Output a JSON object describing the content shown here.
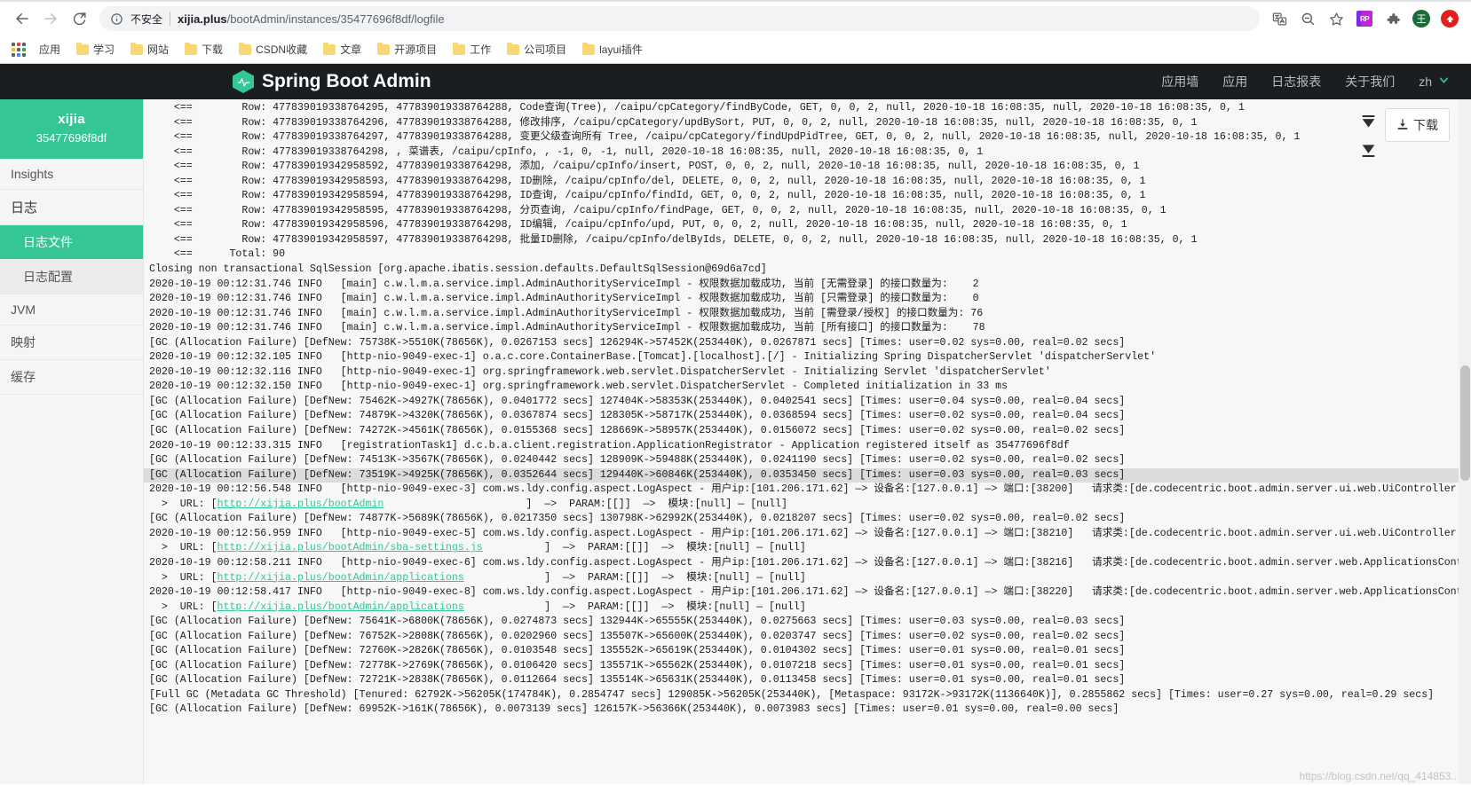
{
  "browser": {
    "back_icon": "back-arrow-icon",
    "forward_icon": "forward-arrow-icon",
    "reload_icon": "reload-icon",
    "security_label": "不安全",
    "url_host": "xijia.plus",
    "url_path": "/bootAdmin/instances/35477696f8df/logfile",
    "url_full": "xijia.plus/bootAdmin/instances/35477696f8df/logfile",
    "toolbar_icons": [
      "translate-icon",
      "zoom-out-icon",
      "bookmark-star-icon",
      "extension-rp-icon",
      "extensions-puzzle-icon",
      "profile-avatar",
      "update-icon"
    ],
    "extension_rp_label": "RP",
    "profile_initial": "王",
    "bookmarks": [
      {
        "label": "应用",
        "icon": "apps-grid-icon"
      },
      {
        "label": "学习",
        "icon": "folder-icon"
      },
      {
        "label": "网站",
        "icon": "folder-icon"
      },
      {
        "label": "下载",
        "icon": "folder-icon"
      },
      {
        "label": "CSDN收藏",
        "icon": "folder-icon"
      },
      {
        "label": "文章",
        "icon": "folder-icon"
      },
      {
        "label": "开源项目",
        "icon": "folder-icon"
      },
      {
        "label": "工作",
        "icon": "folder-icon"
      },
      {
        "label": "公司项目",
        "icon": "folder-icon"
      },
      {
        "label": "layui插件",
        "icon": "folder-icon"
      }
    ]
  },
  "header": {
    "title": "Spring Boot Admin",
    "logo_icon": "spring-boot-admin-hexagon-logo",
    "nav": [
      {
        "label": "应用墙"
      },
      {
        "label": "应用"
      },
      {
        "label": "日志报表"
      },
      {
        "label": "关于我们"
      }
    ],
    "language": "zh",
    "language_chevron_icon": "chevron-down-icon"
  },
  "sidebar": {
    "app_name": "xijia",
    "app_id": "35477696f8df",
    "items": [
      {
        "label": "Insights",
        "type": "item"
      },
      {
        "label": "日志",
        "type": "group"
      },
      {
        "label": "日志文件",
        "type": "sub",
        "active": true
      },
      {
        "label": "日志配置",
        "type": "sub",
        "active": false
      },
      {
        "label": "JVM",
        "type": "item"
      },
      {
        "label": "映射",
        "type": "item"
      },
      {
        "label": "缓存",
        "type": "item"
      }
    ]
  },
  "log_panel": {
    "download_label": "下载",
    "download_icon": "download-icon",
    "scroll_top_icon": "scroll-to-top-icon",
    "scroll_bottom_icon": "scroll-to-bottom-icon",
    "highlighted_line_index": 25,
    "lines": [
      "    <==        Row: 477839019338764295, 477839019338764288, Code查询(Tree), /caipu/cpCategory/findByCode, GET, 0, 0, 2, null, 2020-10-18 16:08:35, null, 2020-10-18 16:08:35, 0, 1",
      "    <==        Row: 477839019338764296, 477839019338764288, 修改排序, /caipu/cpCategory/updBySort, PUT, 0, 0, 2, null, 2020-10-18 16:08:35, null, 2020-10-18 16:08:35, 0, 1",
      "    <==        Row: 477839019338764297, 477839019338764288, 变更父级查询所有 Tree, /caipu/cpCategory/findUpdPidTree, GET, 0, 0, 2, null, 2020-10-18 16:08:35, null, 2020-10-18 16:08:35, 0, 1",
      "    <==        Row: 477839019338764298, , 菜谱表, /caipu/cpInfo, , -1, 0, -1, null, 2020-10-18 16:08:35, null, 2020-10-18 16:08:35, 0, 1",
      "    <==        Row: 477839019342958592, 477839019338764298, 添加, /caipu/cpInfo/insert, POST, 0, 0, 2, null, 2020-10-18 16:08:35, null, 2020-10-18 16:08:35, 0, 1",
      "    <==        Row: 477839019342958593, 477839019338764298, ID删除, /caipu/cpInfo/del, DELETE, 0, 0, 2, null, 2020-10-18 16:08:35, null, 2020-10-18 16:08:35, 0, 1",
      "    <==        Row: 477839019342958594, 477839019338764298, ID查询, /caipu/cpInfo/findId, GET, 0, 0, 2, null, 2020-10-18 16:08:35, null, 2020-10-18 16:08:35, 0, 1",
      "    <==        Row: 477839019342958595, 477839019338764298, 分页查询, /caipu/cpInfo/findPage, GET, 0, 0, 2, null, 2020-10-18 16:08:35, null, 2020-10-18 16:08:35, 0, 1",
      "    <==        Row: 477839019342958596, 477839019338764298, ID编辑, /caipu/cpInfo/upd, PUT, 0, 0, 2, null, 2020-10-18 16:08:35, null, 2020-10-18 16:08:35, 0, 1",
      "    <==        Row: 477839019342958597, 477839019338764298, 批量ID删除, /caipu/cpInfo/delByIds, DELETE, 0, 0, 2, null, 2020-10-18 16:08:35, null, 2020-10-18 16:08:35, 0, 1",
      "    <==      Total: 90",
      "Closing non transactional SqlSession [org.apache.ibatis.session.defaults.DefaultSqlSession@69d6a7cd]",
      "2020-10-19 00:12:31.746 INFO   [main] c.w.l.m.a.service.impl.AdminAuthorityServiceImpl - 权限数据加载成功, 当前 [无需登录] 的接口数量为:    2",
      "2020-10-19 00:12:31.746 INFO   [main] c.w.l.m.a.service.impl.AdminAuthorityServiceImpl - 权限数据加载成功, 当前 [只需登录] 的接口数量为:    0",
      "2020-10-19 00:12:31.746 INFO   [main] c.w.l.m.a.service.impl.AdminAuthorityServiceImpl - 权限数据加载成功, 当前 [需登录/授权] 的接口数量为: 76",
      "2020-10-19 00:12:31.746 INFO   [main] c.w.l.m.a.service.impl.AdminAuthorityServiceImpl - 权限数据加载成功, 当前 [所有接口] 的接口数量为:    78",
      "[GC (Allocation Failure) [DefNew: 75738K->5510K(78656K), 0.0267153 secs] 126294K->57452K(253440K), 0.0267871 secs] [Times: user=0.02 sys=0.00, real=0.02 secs]",
      "2020-10-19 00:12:32.105 INFO   [http-nio-9049-exec-1] o.a.c.core.ContainerBase.[Tomcat].[localhost].[/] - Initializing Spring DispatcherServlet 'dispatcherServlet'",
      "2020-10-19 00:12:32.116 INFO   [http-nio-9049-exec-1] org.springframework.web.servlet.DispatcherServlet - Initializing Servlet 'dispatcherServlet'",
      "2020-10-19 00:12:32.150 INFO   [http-nio-9049-exec-1] org.springframework.web.servlet.DispatcherServlet - Completed initialization in 33 ms",
      "[GC (Allocation Failure) [DefNew: 75462K->4927K(78656K), 0.0401772 secs] 127404K->58353K(253440K), 0.0402541 secs] [Times: user=0.04 sys=0.00, real=0.04 secs]",
      "[GC (Allocation Failure) [DefNew: 74879K->4320K(78656K), 0.0367874 secs] 128305K->58717K(253440K), 0.0368594 secs] [Times: user=0.02 sys=0.00, real=0.04 secs]",
      "[GC (Allocation Failure) [DefNew: 74272K->4561K(78656K), 0.0155368 secs] 128669K->58957K(253440K), 0.0156072 secs] [Times: user=0.02 sys=0.00, real=0.02 secs]",
      "2020-10-19 00:12:33.315 INFO   [registrationTask1] d.c.b.a.client.registration.ApplicationRegistrator - Application registered itself as 35477696f8df",
      "[GC (Allocation Failure) [DefNew: 74513K->3567K(78656K), 0.0240442 secs] 128909K->59488K(253440K), 0.0241190 secs] [Times: user=0.02 sys=0.00, real=0.02 secs]",
      "[GC (Allocation Failure) [DefNew: 73519K->4925K(78656K), 0.0352644 secs] 129440K->60846K(253440K), 0.0353450 secs] [Times: user=0.03 sys=0.00, real=0.03 secs]",
      "2020-10-19 00:12:56.548 INFO   [http-nio-9049-exec-3] com.ws.ldy.config.aspect.LogAspect - 用户ip:[101.206.171.62] —> 设备名:[127.0.0.1] —> 端口:[38200]   请求类:[de.codecentric.boot.admin.server.ui.web.UiController            ]  —",
      "  >  URL: [http://xijia.plus/bootAdmin                       ]  —>  PARAM:[[]]  —>  模块:[null] — [null]",
      "[GC (Allocation Failure) [DefNew: 74877K->5689K(78656K), 0.0217350 secs] 130798K->62992K(253440K), 0.0218207 secs] [Times: user=0.02 sys=0.00, real=0.02 secs]",
      "2020-10-19 00:12:56.959 INFO   [http-nio-9049-exec-5] com.ws.ldy.config.aspect.LogAspect - 用户ip:[101.206.171.62] —> 设备名:[127.0.0.1] —> 端口:[38210]   请求类:[de.codecentric.boot.admin.server.ui.web.UiController            ]  —",
      "  >  URL: [http://xijia.plus/bootAdmin/sba-settings.js          ]  —>  PARAM:[[]]  —>  模块:[null] — [null]",
      "2020-10-19 00:12:58.211 INFO   [http-nio-9049-exec-6] com.ws.ldy.config.aspect.LogAspect - 用户ip:[101.206.171.62] —> 设备名:[127.0.0.1] —> 端口:[38216]   请求类:[de.codecentric.boot.admin.server.web.ApplicationsController      ]  —",
      "  >  URL: [http://xijia.plus/bootAdmin/applications             ]  —>  PARAM:[[]]  —>  模块:[null] — [null]",
      "2020-10-19 00:12:58.417 INFO   [http-nio-9049-exec-8] com.ws.ldy.config.aspect.LogAspect - 用户ip:[101.206.171.62] —> 设备名:[127.0.0.1] —> 端口:[38220]   请求类:[de.codecentric.boot.admin.server.web.ApplicationsController      ]  —",
      "  >  URL: [http://xijia.plus/bootAdmin/applications             ]  —>  PARAM:[[]]  —>  模块:[null] — [null]",
      "[GC (Allocation Failure) [DefNew: 75641K->6800K(78656K), 0.0274873 secs] 132944K->65555K(253440K), 0.0275663 secs] [Times: user=0.03 sys=0.00, real=0.03 secs]",
      "[GC (Allocation Failure) [DefNew: 76752K->2808K(78656K), 0.0202960 secs] 135507K->65600K(253440K), 0.0203747 secs] [Times: user=0.02 sys=0.00, real=0.02 secs]",
      "[GC (Allocation Failure) [DefNew: 72760K->2826K(78656K), 0.0103548 secs] 135552K->65619K(253440K), 0.0104302 secs] [Times: user=0.01 sys=0.00, real=0.01 secs]",
      "[GC (Allocation Failure) [DefNew: 72778K->2769K(78656K), 0.0106420 secs] 135571K->65562K(253440K), 0.0107218 secs] [Times: user=0.01 sys=0.00, real=0.01 secs]",
      "[GC (Allocation Failure) [DefNew: 72721K->2838K(78656K), 0.0112664 secs] 135514K->65631K(253440K), 0.0113458 secs] [Times: user=0.01 sys=0.00, real=0.01 secs]",
      "[Full GC (Metadata GC Threshold) [Tenured: 62792K->56205K(174784K), 0.2854747 secs] 129085K->56205K(253440K), [Metaspace: 93172K->93172K(1136640K)], 0.2855862 secs] [Times: user=0.27 sys=0.00, real=0.29 secs]",
      "[GC (Allocation Failure) [DefNew: 69952K->161K(78656K), 0.0073139 secs] 126157K->56366K(253440K), 0.0073983 secs] [Times: user=0.01 sys=0.00, real=0.00 secs]"
    ],
    "url_lines": [
      {
        "index": 27,
        "prefix": "  >  URL: [",
        "url": "http://xijia.plus/bootAdmin",
        "suffix": "                       ]  —>  PARAM:[[]]  —>  模块:[null] — [null]"
      },
      {
        "index": 30,
        "prefix": "  >  URL: [",
        "url": "http://xijia.plus/bootAdmin/sba-settings.js",
        "suffix": "          ]  —>  PARAM:[[]]  —>  模块:[null] — [null]"
      },
      {
        "index": 32,
        "prefix": "  >  URL: [",
        "url": "http://xijia.plus/bootAdmin/applications",
        "suffix": "             ]  —>  PARAM:[[]]  —>  模块:[null] — [null]"
      },
      {
        "index": 34,
        "prefix": "  >  URL: [",
        "url": "http://xijia.plus/bootAdmin/applications",
        "suffix": "             ]  —>  PARAM:[[]]  —>  模块:[null] — [null]"
      }
    ]
  },
  "watermark": "https://blog.csdn.net/qq_414853..",
  "colors": {
    "brand_green": "#34c795",
    "header_dark": "#1b1e21",
    "link_green": "#34c795",
    "highlight_gray": "#dcdcdc"
  }
}
